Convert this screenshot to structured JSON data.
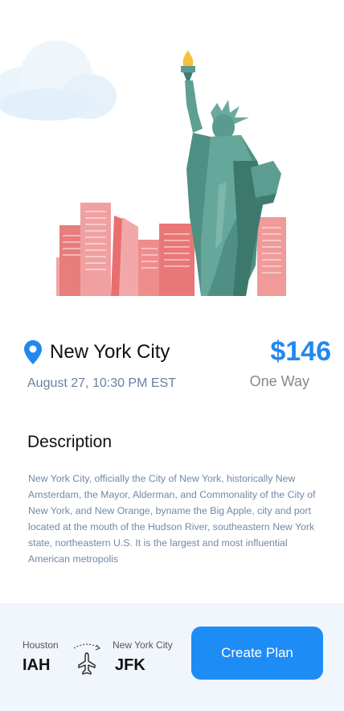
{
  "destination": {
    "city": "New York City",
    "datetime": "August 27, 10:30 PM EST",
    "price": "$146",
    "trip_type": "One Way"
  },
  "description": {
    "heading": "Description",
    "body": "New York City, officially the City of New York, historically New Amsterdam, the Mayor, Alderman, and Commonality of the City of New York, and New Orange, byname the Big Apple, city and port located at the mouth of the Hudson River, southeastern New York state, northeastern U.S. It is the largest and most influential American metropolis"
  },
  "flight": {
    "origin_city": "Houston",
    "origin_code": "IAH",
    "destination_city": "New York City",
    "destination_code": "JFK"
  },
  "actions": {
    "create_plan_label": "Create Plan"
  },
  "colors": {
    "accent": "#1e8cf5",
    "price": "#2288f0",
    "muted_text": "#7288a6",
    "bottom_bar": "#f1f5fc",
    "statue": "#4f8f84",
    "buildings": "#ea7a7a"
  },
  "icons": {
    "location": "location-pin-icon",
    "flight": "airplane-icon"
  }
}
